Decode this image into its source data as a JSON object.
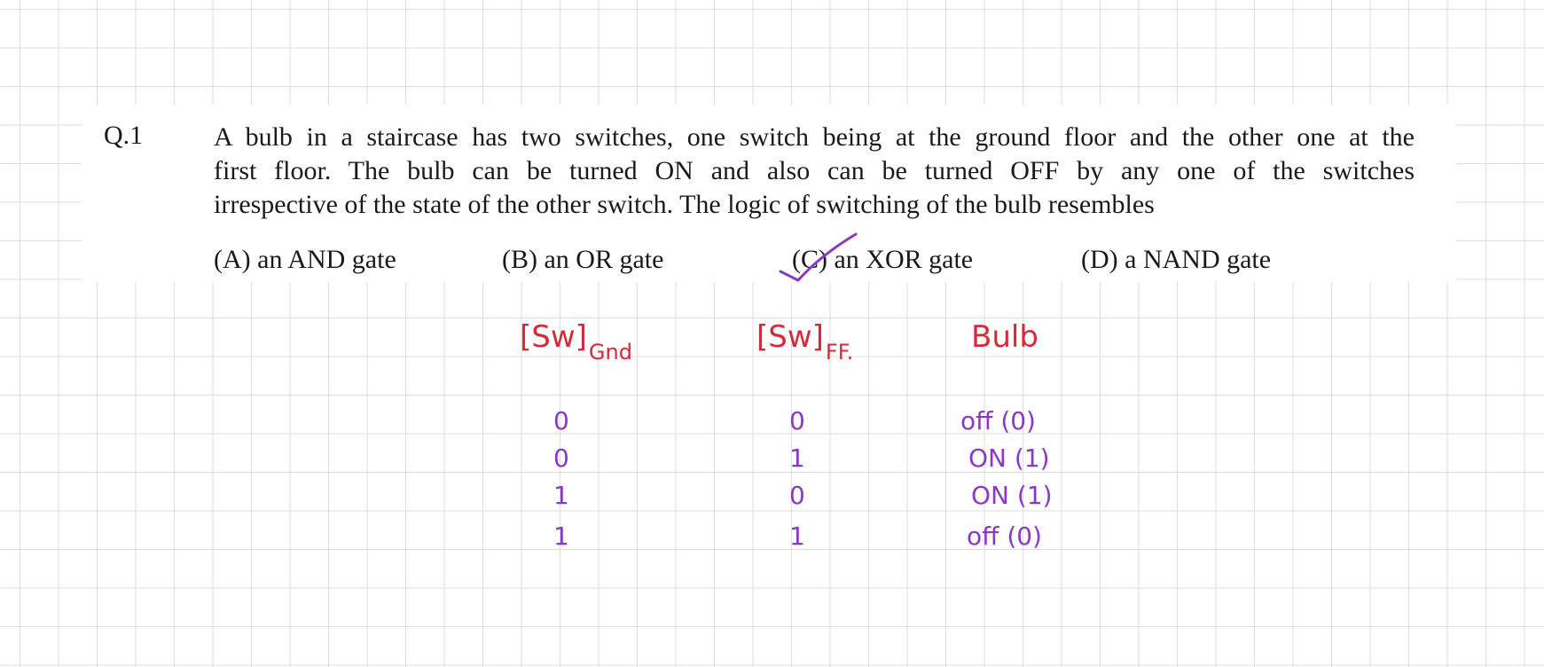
{
  "question": {
    "number": "Q.1",
    "lines": [
      "A bulb in a staircase has two switches, one switch being at the ground floor and the other one at the",
      "first floor. The bulb can be turned ON and also can be turned OFF by any one of the switches",
      "irrespective of the state of the other switch. The logic of switching of the bulb resembles"
    ],
    "options": [
      {
        "label": "(A) an AND gate"
      },
      {
        "label": "(B) an OR gate"
      },
      {
        "label": "(C) an XOR gate",
        "marked": true
      },
      {
        "label": "(D) a NAND gate"
      }
    ]
  },
  "annotations": {
    "headers": {
      "sw_gnd": {
        "main": "[Sw]",
        "sub": "Gnd"
      },
      "sw_ff": {
        "main": "[Sw]",
        "sub": "FF."
      },
      "bulb": "Bulb"
    },
    "rows": [
      {
        "gnd": "0",
        "ff": "0",
        "bulb": "off (0)"
      },
      {
        "gnd": "0",
        "ff": "1",
        "bulb": "ON (1)"
      },
      {
        "gnd": "1",
        "ff": "0",
        "bulb": "ON (1)"
      },
      {
        "gnd": "1",
        "ff": "1",
        "bulb": "off (0)"
      }
    ],
    "colors": {
      "header_ink": "#d42a3a",
      "table_ink": "#8a38c8"
    }
  }
}
